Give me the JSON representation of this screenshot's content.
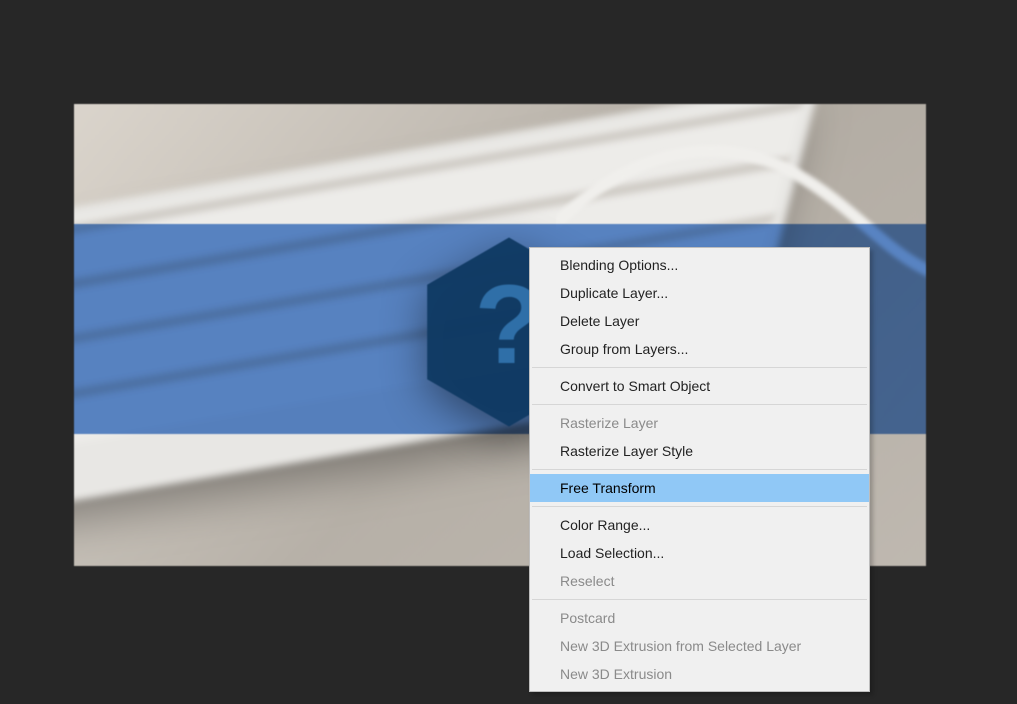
{
  "contextMenu": {
    "groups": [
      [
        {
          "label": "Blending Options...",
          "enabled": true
        },
        {
          "label": "Duplicate Layer...",
          "enabled": true
        },
        {
          "label": "Delete Layer",
          "enabled": true
        },
        {
          "label": "Group from Layers...",
          "enabled": true
        }
      ],
      [
        {
          "label": "Convert to Smart Object",
          "enabled": true
        }
      ],
      [
        {
          "label": "Rasterize Layer",
          "enabled": false
        },
        {
          "label": "Rasterize Layer Style",
          "enabled": true
        }
      ],
      [
        {
          "label": "Free Transform",
          "enabled": true,
          "highlighted": true
        }
      ],
      [
        {
          "label": "Color Range...",
          "enabled": true
        },
        {
          "label": "Load Selection...",
          "enabled": true
        },
        {
          "label": "Reselect",
          "enabled": false
        }
      ],
      [
        {
          "label": "Postcard",
          "enabled": false
        },
        {
          "label": "New 3D Extrusion from Selected Layer",
          "enabled": false
        },
        {
          "label": "New 3D Extrusion",
          "enabled": false
        }
      ]
    ]
  },
  "canvasOverlay": {
    "logoIcon": "question-mark-hexagon"
  }
}
